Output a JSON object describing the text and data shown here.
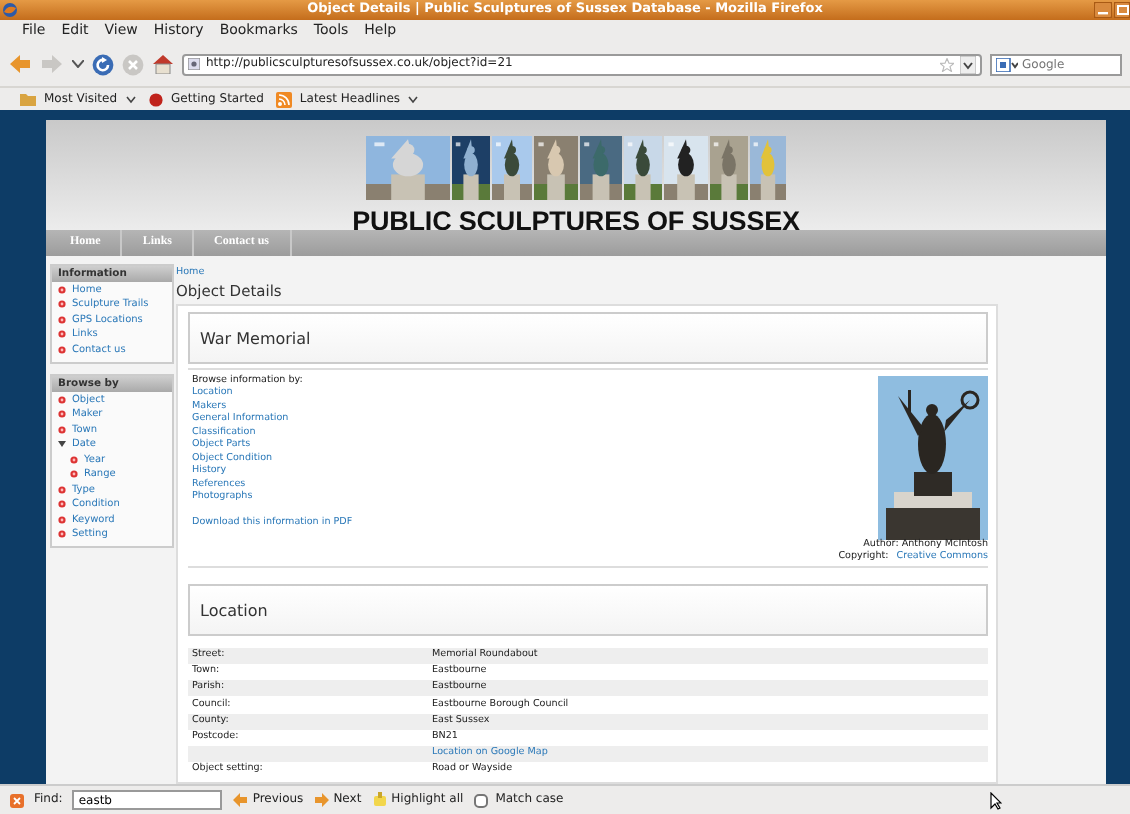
{
  "window": {
    "title": "Object Details | Public Sculptures of Sussex Database - Mozilla Firefox"
  },
  "menu": [
    "File",
    "Edit",
    "View",
    "History",
    "Bookmarks",
    "Tools",
    "Help"
  ],
  "address": {
    "url": "http://publicsculpturesofsussex.co.uk/object?id=21"
  },
  "search": {
    "placeholder": "Google"
  },
  "bookmarks": [
    {
      "label": "Most Visited",
      "kind": "folder"
    },
    {
      "label": "Getting Started",
      "kind": "page"
    },
    {
      "label": "Latest Headlines",
      "kind": "feed"
    }
  ],
  "site": {
    "title": "PUBLIC SCULPTURES OF SUSSEX",
    "nav": [
      "Home",
      "Links",
      "Contact us"
    ]
  },
  "sidebar": [
    {
      "heading": "Information",
      "items": [
        {
          "label": "Home"
        },
        {
          "label": "Sculpture Trails"
        },
        {
          "label": "GPS Locations"
        },
        {
          "label": "Links"
        },
        {
          "label": "Contact us"
        }
      ]
    },
    {
      "heading": "Browse by",
      "items": [
        {
          "label": "Object"
        },
        {
          "label": "Maker"
        },
        {
          "label": "Town"
        },
        {
          "label": "Date",
          "expanded": true,
          "children": [
            {
              "label": "Year"
            },
            {
              "label": "Range"
            }
          ]
        },
        {
          "label": "Type"
        },
        {
          "label": "Condition"
        },
        {
          "label": "Keyword"
        },
        {
          "label": "Setting"
        }
      ]
    }
  ],
  "breadcrumb": "Home",
  "page_heading": "Object Details",
  "object_title": "War Memorial",
  "browse": {
    "label": "Browse information by:",
    "links": [
      "Location",
      "Makers",
      "General Information",
      "Classification",
      "Object Parts",
      "Object Condition",
      "History",
      "References",
      "Photographs"
    ],
    "pdf_link": "Download this information in PDF"
  },
  "photo": {
    "author": "Author: Anthony McIntosh",
    "copyright_label": "Copyright:",
    "copyright_link": "Creative Commons"
  },
  "location": {
    "heading": "Location",
    "rows": [
      {
        "label": "Street:",
        "value": "Memorial Roundabout",
        "kind": "text"
      },
      {
        "label": "Town:",
        "value": "Eastbourne",
        "kind": "text"
      },
      {
        "label": "Parish:",
        "value": "Eastbourne",
        "kind": "text"
      },
      {
        "label": "Council:",
        "value": "Eastbourne Borough Council",
        "kind": "text"
      },
      {
        "label": "County:",
        "value": "East Sussex",
        "kind": "text"
      },
      {
        "label": "Postcode:",
        "value": "BN21",
        "kind": "text"
      },
      {
        "value": "Location on Google Map",
        "kind": "link"
      },
      {
        "label": "Object setting:",
        "value": "Road or Wayside",
        "kind": "text"
      }
    ]
  },
  "find_bar": {
    "label": "Find:",
    "value": "eastb",
    "buttons": [
      "Previous",
      "Next",
      "Highlight all"
    ],
    "match_case": {
      "label": "Match case",
      "checked": false
    }
  }
}
